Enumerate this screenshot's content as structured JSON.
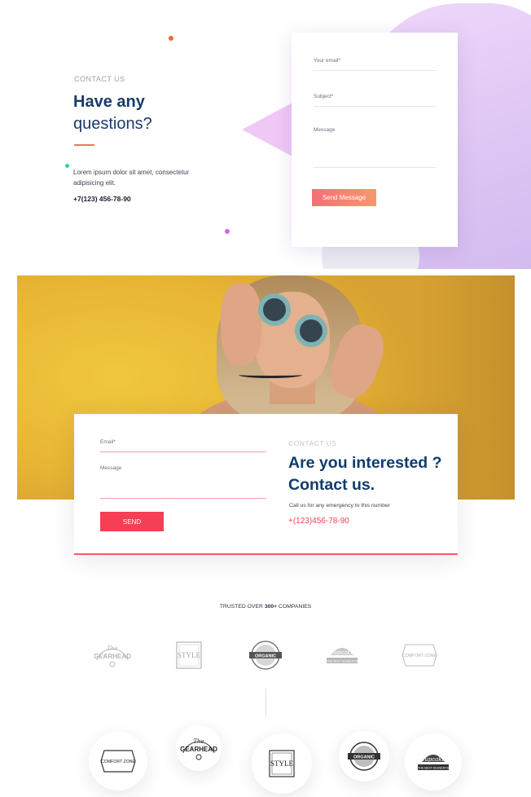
{
  "section1": {
    "eyebrow": "CONTACT US",
    "title_line1": "Have any",
    "title_line2": "questions?",
    "text": "Lorem ipsum dolor sit amet, consectetur adipisicing elit.",
    "phone": "+7(123) 456-78-90",
    "form": {
      "email_label": "Your email*",
      "subject_label": "Subject*",
      "message_label": "Message",
      "send_label": "Send Message"
    }
  },
  "section2": {
    "form": {
      "email_label": "Email*",
      "message_label": "Message",
      "send_label": "SEND"
    },
    "eyebrow": "CONTACT US",
    "title_line1": "Are you interested ?",
    "title_line2": "Contact us.",
    "text": "Call us for any emergency to this number",
    "phone": "+(123)456-78-90"
  },
  "section3": {
    "trusted_prefix": "TRUSTED OVER ",
    "trusted_count": "300+",
    "trusted_suffix": " COMPANIES",
    "logos": {
      "gearhead_top": "GEARHEAD",
      "gearhead_script": "The",
      "style": "STYLE",
      "organic": "ORGANIC",
      "cupcake": "cupcake",
      "cupcake_sub": "THE BEST DESSERTS",
      "comfort": "COMFORT ZONE"
    }
  },
  "colors": {
    "navy": "#1b3a6b",
    "coral": "#f0765a",
    "red": "#f43f54",
    "lavender": "#dcc4f3"
  },
  "icons": [
    "gearhead-logo-icon",
    "style-logo-icon",
    "organic-logo-icon",
    "cupcake-logo-icon",
    "comfort-zone-logo-icon"
  ]
}
